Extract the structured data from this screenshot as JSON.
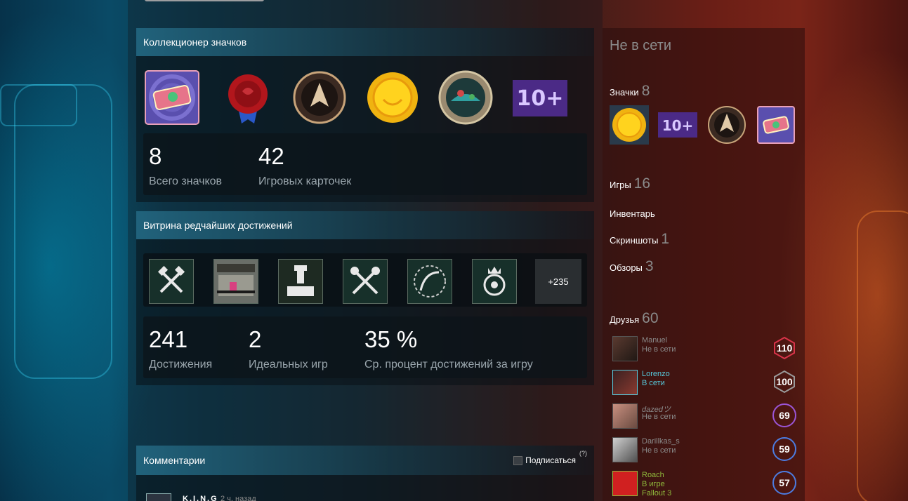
{
  "badge_panel": {
    "title": "Коллекционер значков",
    "total_badges": "8",
    "total_badges_label": "Всего значков",
    "game_cards": "42",
    "game_cards_label": "Игровых карточек",
    "badges": [
      "ticket-badge-icon",
      "wax-seal-badge-icon",
      "laurel-emblem-badge-icon",
      "gold-coin-badge-icon",
      "porthole-badge-icon",
      "10-plus-badge-icon"
    ],
    "badge_10_text": "10+"
  },
  "achievements_panel": {
    "title": "Витрина редчайших достижений",
    "more_label": "+235",
    "achievements_count": "241",
    "achievements_label": "Достижения",
    "perfect_games": "2",
    "perfect_games_label": "Идеальных игр",
    "avg_percent": "35 %",
    "avg_percent_label": "Ср. процент достижений за игру"
  },
  "comments_panel": {
    "title": "Комментарии",
    "subscribe_label": "Подписаться",
    "help_mark": "(?)",
    "first_comment_author": "K.I.N.G",
    "first_comment_time": "2 ч. назад"
  },
  "sidebar": {
    "status": "Не в сети",
    "badges_label": "Значки",
    "badges_count": "8",
    "badge_10_text": "10+",
    "games_label": "Игры",
    "games_count": "16",
    "inventory_label": "Инвентарь",
    "screenshots_label": "Скриншоты",
    "screenshots_count": "1",
    "reviews_label": "Обзоры",
    "reviews_count": "3",
    "friends_label": "Друзья",
    "friends_count": "60"
  },
  "friends": [
    {
      "name": "Manuel",
      "status": "Не в сети",
      "level": "110",
      "state": "offline",
      "level_color": "#d9344a"
    },
    {
      "name": "Lorenzo",
      "status": "В сети",
      "level": "100",
      "state": "online",
      "level_color": "#9a9a9a"
    },
    {
      "name": "dazedツ",
      "status": "Не в сети",
      "level": "69",
      "state": "offline",
      "level_color": "#9b55d6"
    },
    {
      "name": "Darillkas_s",
      "status": "Не в сети",
      "level": "59",
      "state": "offline",
      "level_color": "#4c7ce0"
    },
    {
      "name": "Roach",
      "status": "В игре",
      "game": "Fallout 3",
      "level": "57",
      "state": "ingame",
      "level_color": "#4c7ce0"
    }
  ],
  "colors": {
    "online": "#57cbde",
    "ingame": "#90ba3c",
    "offline": "#8a8a8a"
  }
}
